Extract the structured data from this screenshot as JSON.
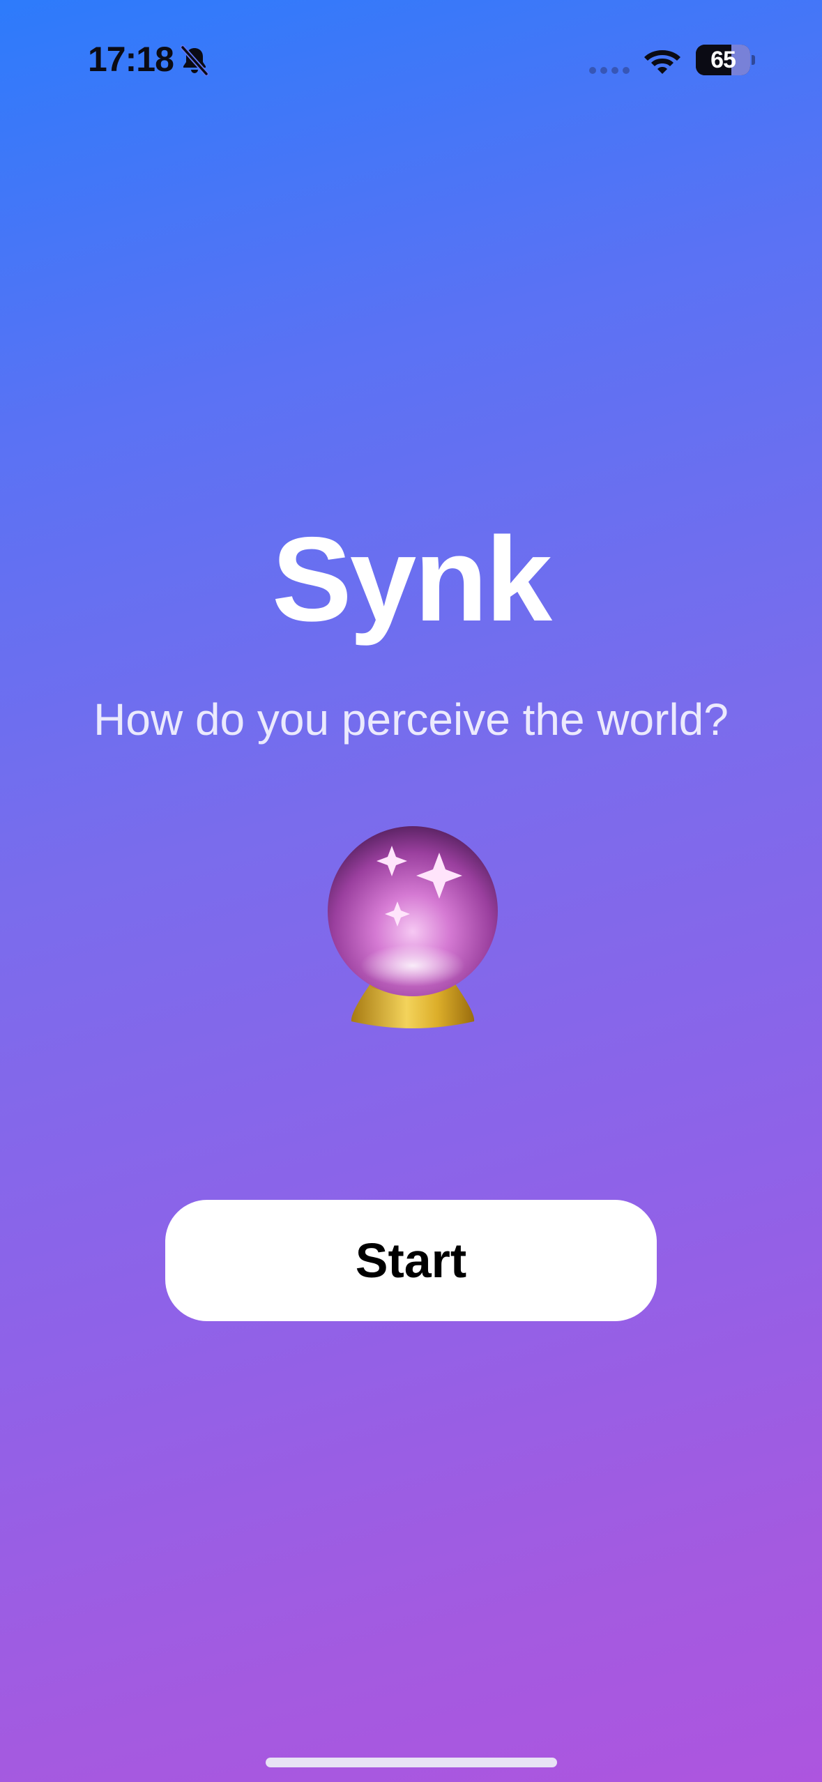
{
  "status_bar": {
    "time": "17:18",
    "battery_level": "65",
    "battery_fraction": 0.65,
    "silent_icon": "bell-slash-icon",
    "signal_icon": "cellular-dots-icon",
    "wifi_icon": "wifi-icon"
  },
  "main": {
    "title": "Synk",
    "tagline": "How do you perceive the world?",
    "hero_icon": "crystal-ball-icon",
    "start_label": "Start"
  },
  "colors": {
    "gradient_top": "#2d7bfb",
    "gradient_bottom": "#ad55df",
    "button_bg": "#ffffff",
    "button_text": "#000000"
  }
}
